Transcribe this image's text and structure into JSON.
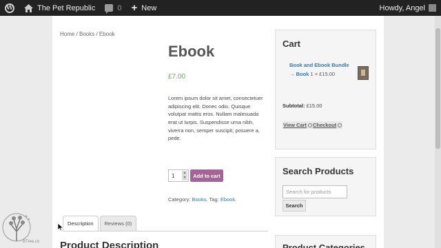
{
  "adminbar": {
    "logo": "wordpress-logo",
    "site_name": "The Pet Republic",
    "comments_count": "0",
    "new_label": "New",
    "greeting": "Howdy, Angel"
  },
  "breadcrumb": "Home / Books / Ebook",
  "product": {
    "title": "Ebook",
    "price": "£7.00",
    "description": "Lorem ipsum dolor sit amet, consectetuer adipiscing elit. Donec odio. Quisque volutpat mattis eros. Nullam malesuada erat ut turpis. Suspendisse urna nibh, viverra non, semper suscipit, posuere a, pede.",
    "quantity": "1",
    "add_to_cart": "Add to cart",
    "category_label": "Category:",
    "category": "Books",
    "tag_label": "Tag:",
    "tag": "Ebook",
    "accent": "#a46497",
    "price_color": "#77a464"
  },
  "tabs": [
    {
      "label": "Description"
    },
    {
      "label": "Reviews (0)"
    }
  ],
  "section_heading": "Product Description",
  "cart": {
    "title": "Cart",
    "item_name": "Book and Ebook Bundle → Book",
    "item_qty": "1 × £15.00",
    "subtotal_label": "Subtotal:",
    "subtotal_value": "£15.00",
    "view_cart": "View Cart",
    "checkout": "Checkout"
  },
  "search": {
    "title": "Search Products",
    "placeholder": "Search for products",
    "button": "Search"
  },
  "categories": {
    "title": "Product Categories"
  },
  "watermark": "BTree.co"
}
